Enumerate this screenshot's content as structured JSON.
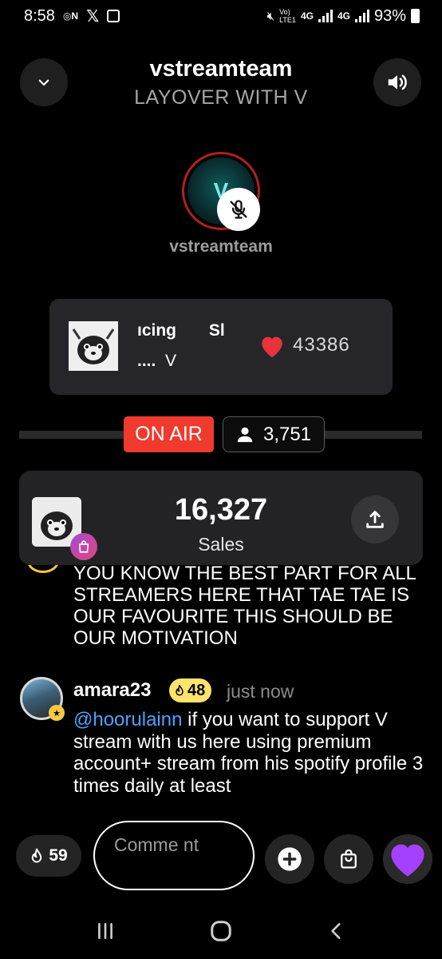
{
  "status_bar": {
    "time": "8:58",
    "left_icons": [
      "nfc-icon",
      "x-app-icon",
      "checkbox-notification-icon"
    ],
    "network_label_top": "Vo)",
    "network_label_bottom": "LTE1",
    "network_1": "4G",
    "network_2": "4G",
    "battery": "93%"
  },
  "header": {
    "host": "vstreamteam",
    "room_title": "LAYOVER WITH V",
    "collapse_icon": "chevron-down-icon",
    "sound_icon": "speaker-icon"
  },
  "host_profile": {
    "name": "vstreamteam",
    "avatar_text": "V",
    "mic_state_icon": "mic-off-icon"
  },
  "now_playing": {
    "song": "ıcing",
    "song_trailing": "Sl",
    "artist_dots": "....",
    "artist": "V",
    "likes": "43386",
    "heart_color": "#e8333a"
  },
  "live": {
    "on_air_label": "ON AIR",
    "listeners": "3,751",
    "on_air_color": "#f03a2e"
  },
  "sales": {
    "count": "16,327",
    "label": "Sales"
  },
  "chat": {
    "previous_message": "YOU KNOW THE BEST PART FOR ALL STREAMERS HERE THAT TAE TAE IS OUR FAVOURITE THIS SHOULD BE OUR MOTIVATION",
    "message": {
      "user": "amara23",
      "level": "48",
      "time": "just now",
      "mention": "@hoorulainn",
      "text": " if you want to support V stream with us here using premium account+ stream from his spotify profile 3 times daily at least"
    }
  },
  "action_bar": {
    "fire_count": "59",
    "comment_placeholder": "Comme nt",
    "heart_color": "#a640ff"
  },
  "navbar": {
    "items": [
      "recents-icon",
      "home-icon",
      "back-icon"
    ]
  }
}
